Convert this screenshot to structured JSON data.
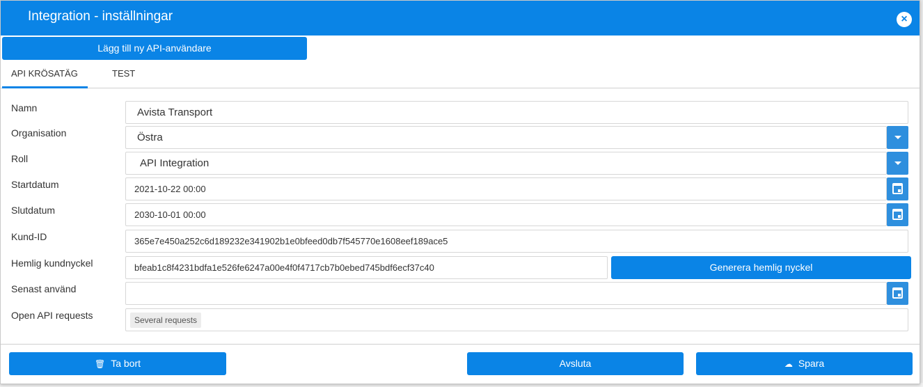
{
  "dialog": {
    "title": "Integration - inställningar",
    "close_icon": "×"
  },
  "toolbar": {
    "add_user_label": "Lägg till ny API-användare"
  },
  "tabs": [
    {
      "label": "API KRÖSATÄG",
      "active": true
    },
    {
      "label": "TEST",
      "active": false
    }
  ],
  "form": {
    "name": {
      "label": "Namn",
      "value": "Avista Transport"
    },
    "organisation": {
      "label": "Organisation",
      "value": "Östra"
    },
    "role": {
      "label": "Roll",
      "value": "API Integration"
    },
    "start_date": {
      "label": "Startdatum",
      "value": "2021-10-22 00:00"
    },
    "end_date": {
      "label": "Slutdatum",
      "value": "2030-10-01 00:00"
    },
    "customer_id": {
      "label": "Kund-ID",
      "value": "365e7e450a252c6d189232e341902b1e0bfeed0db7f545770e1608eef189ace5"
    },
    "secret_key": {
      "label": "Hemlig kundnyckel",
      "value": "bfeab1c8f4231bdfa1e526fe6247a00e4f0f4717cb7b0ebed745bdf6ecf37c40",
      "generate_label": "Generera hemlig nyckel"
    },
    "last_used": {
      "label": "Senast använd",
      "value": ""
    },
    "open_api": {
      "label": "Open API requests",
      "chip": "Several requests"
    }
  },
  "footer": {
    "delete_label": "Ta bort",
    "close_label": "Avsluta",
    "save_label": "Spara"
  },
  "colors": {
    "accent": "#0a84e6",
    "button_secondary": "#2e8fde"
  }
}
